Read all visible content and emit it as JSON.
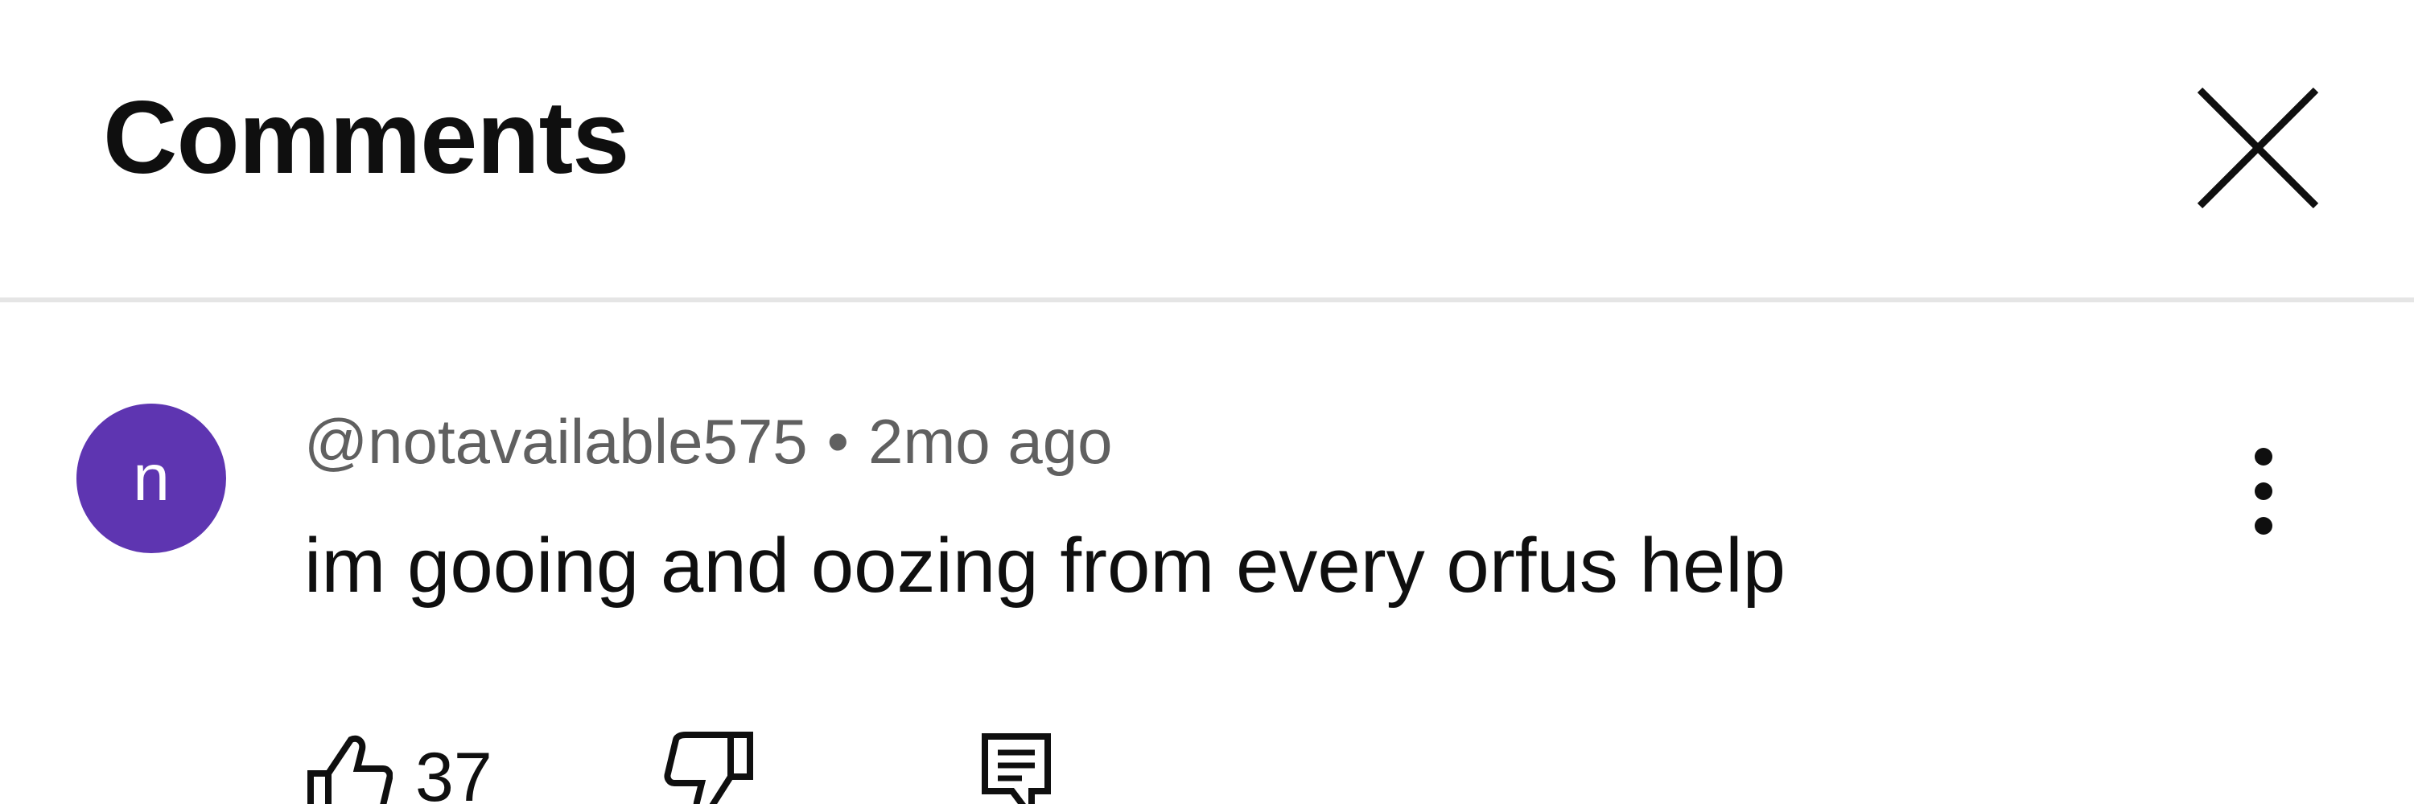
{
  "header": {
    "title": "Comments",
    "close_icon": "close-icon"
  },
  "comment": {
    "avatar_letter": "n",
    "avatar_color": "#5e35b1",
    "author": "@notavailable575",
    "separator": "•",
    "time": "2mo ago",
    "text": "im gooing and oozing from every orfus help",
    "like_count": "37",
    "icons": {
      "like": "thumbs-up-icon",
      "dislike": "thumbs-down-icon",
      "reply": "reply-icon",
      "menu": "more-vert-icon"
    }
  }
}
